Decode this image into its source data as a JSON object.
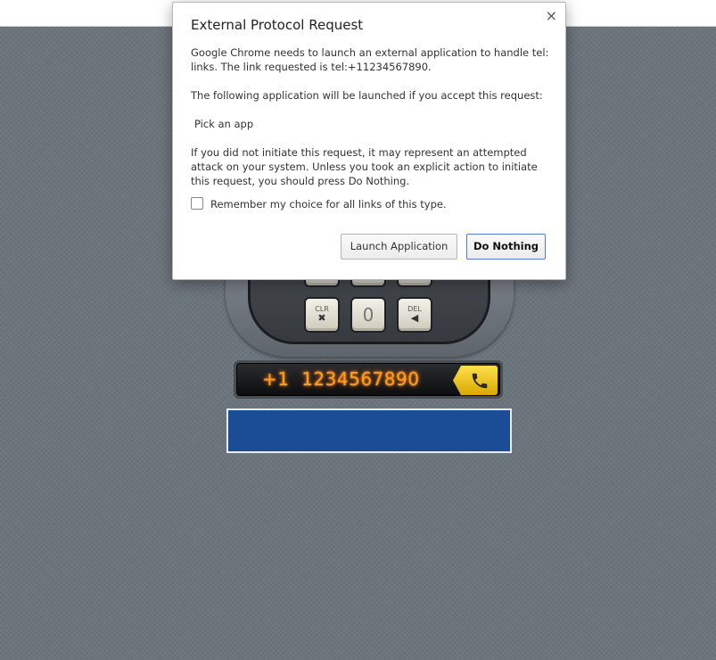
{
  "dialog": {
    "title": "External Protocol Request",
    "message_1": "Google Chrome needs to launch an external application to handle tel: links. The link requested is tel:+11234567890.",
    "message_2": "The following application will be launched if you accept this request:",
    "application_name": "Pick an app",
    "warning": "If you did not initiate this request, it may represent an attempted attack on your system. Unless you took an explicit action to initiate this request, you should press Do Nothing.",
    "remember_label": "Remember my choice for all links of this type.",
    "remember_checked": false,
    "launch_button": "Launch Application",
    "do_nothing_button": "Do Nothing",
    "close_glyph": "×"
  },
  "dialer": {
    "keys": {
      "clear_label": "CLR",
      "clear_glyph": "✖",
      "zero_label": "0",
      "delete_label": "DEL",
      "delete_glyph": "◀"
    },
    "display_number": "+1  1234567890",
    "call_icon": "phone-icon"
  },
  "colors": {
    "accent_blue": "#4d7fd6",
    "number_orange": "#ff9c1a",
    "call_yellow": "#f2c200",
    "blue_box": "#1a4d96"
  }
}
